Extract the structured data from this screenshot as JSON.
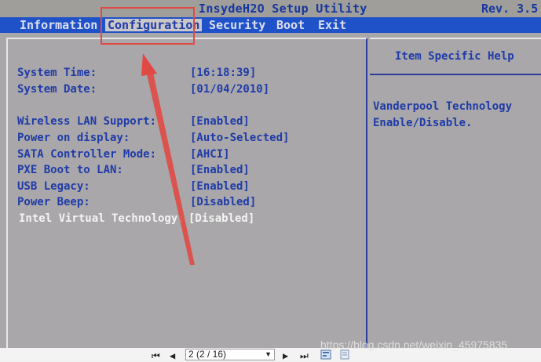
{
  "window": {
    "title": "InsydeH2O Setup Utility",
    "revision": "Rev. 3.5"
  },
  "menu": {
    "tabs": [
      {
        "label": "Information"
      },
      {
        "label": "Configuration"
      },
      {
        "label": "Security"
      },
      {
        "label": "Boot"
      },
      {
        "label": "Exit"
      }
    ],
    "active": "Configuration"
  },
  "settings": [
    {
      "label": "System Time:",
      "value": "[16:18:39]"
    },
    {
      "label": "System Date:",
      "value": "[01/04/2010]"
    },
    {
      "label": "Wireless LAN Support:",
      "value": "[Enabled]"
    },
    {
      "label": "Power on display:",
      "value": "[Auto-Selected]"
    },
    {
      "label": "SATA Controller Mode:",
      "value": "[AHCI]"
    },
    {
      "label": "PXE Boot to LAN:",
      "value": "[Enabled]"
    },
    {
      "label": "USB Legacy:",
      "value": "[Enabled]"
    },
    {
      "label": "Power Beep:",
      "value": "[Disabled]"
    },
    {
      "label": "Intel Virtual Technology:",
      "value": "[Disabled]"
    }
  ],
  "help": {
    "title": "Item Specific Help",
    "lines": [
      "Vanderpool Technology",
      "Enable/Disable."
    ]
  },
  "viewer": {
    "page_select": "2 (2 / 16)"
  },
  "watermark": "https://blog.csdn.net/weixin_45975835",
  "colors": {
    "bios_bg": "#a9a7a9",
    "menu_bar": "#1f52c9",
    "text_blue": "#1f3ba8",
    "annotation_red": "#e04a44"
  }
}
